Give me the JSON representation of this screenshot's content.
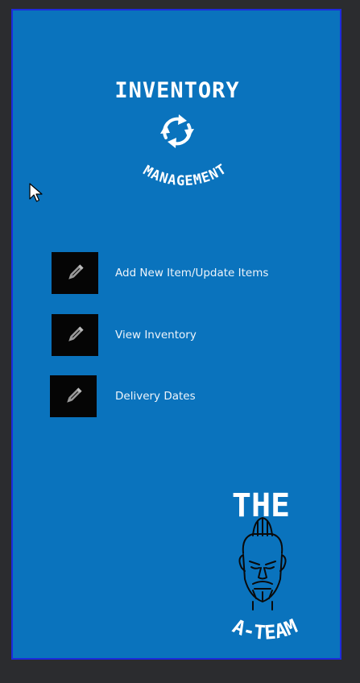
{
  "logo": {
    "top_text": "INVENTORY",
    "bottom_text": "MANAGEMENT",
    "icon": "sync-arrows-icon"
  },
  "menu": {
    "items": [
      {
        "label": "Add New Item/Update Items",
        "icon": "pencil-icon"
      },
      {
        "label": "View Inventory",
        "icon": "pencil-icon"
      },
      {
        "label": "Delivery Dates",
        "icon": "pencil-icon"
      }
    ]
  },
  "team_logo": {
    "top_text": "THE",
    "bottom_text": "A-TEAM",
    "icon": "mohawk-face-icon"
  },
  "colors": {
    "background": "#0a73bd",
    "frame_border": "#1d2bdc",
    "icon_tile": "#050505",
    "text": "#eef4fa"
  }
}
